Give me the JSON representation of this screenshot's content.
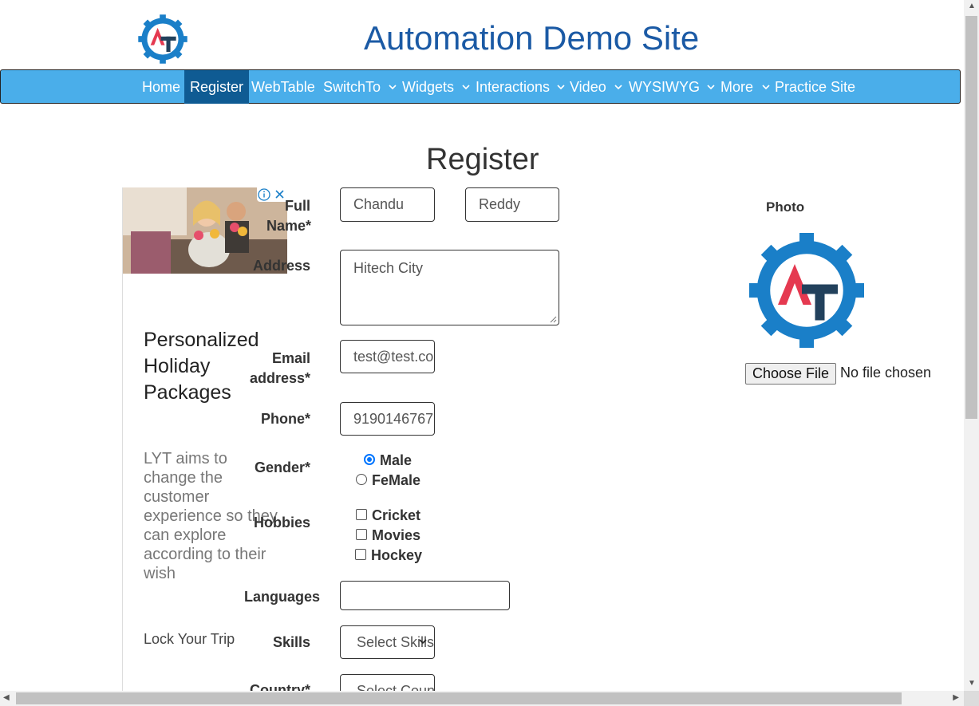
{
  "header": {
    "title": "Automation Demo Site",
    "logo_icon": "gear-logo"
  },
  "nav": {
    "items": [
      {
        "label": "Home",
        "dropdown": false
      },
      {
        "label": "Register",
        "dropdown": false,
        "active": true
      },
      {
        "label": "WebTable",
        "dropdown": false
      },
      {
        "label": "SwitchTo",
        "dropdown": true
      },
      {
        "label": "Widgets",
        "dropdown": true
      },
      {
        "label": "Interactions",
        "dropdown": true
      },
      {
        "label": "Video",
        "dropdown": true
      },
      {
        "label": "WYSIWYG",
        "dropdown": true
      },
      {
        "label": "More",
        "dropdown": true
      },
      {
        "label": "Practice Site",
        "dropdown": false
      }
    ],
    "bg": "#4aaeea",
    "active_bg": "#0f5b93"
  },
  "page": {
    "heading": "Register"
  },
  "ad": {
    "headline": "Personalized Holiday Packages",
    "body": "LYT aims to change the customer experience so they can explore according to their wish",
    "cta": "Lock Your Trip"
  },
  "form": {
    "full_name_label": "Full Name*",
    "first_name": "Chandu",
    "last_name": "Reddy",
    "address_label": "Address",
    "address": "Hitech City",
    "email_label": "Email address*",
    "email": "test@test.com",
    "phone_label": "Phone*",
    "phone": "9190146767",
    "gender_label": "Gender*",
    "gender_options": [
      "Male",
      "FeMale"
    ],
    "gender_selected": "Male",
    "hobbies_label": "Hobbies",
    "hobbies": [
      "Cricket",
      "Movies",
      "Hockey"
    ],
    "languages_label": "Languages",
    "languages": "",
    "skills_label": "Skills",
    "skills_selected": "Select Skills",
    "country_label": "Country*",
    "country_selected": "Select Country"
  },
  "photo": {
    "label": "Photo",
    "button": "Choose File",
    "status": "No file chosen"
  }
}
